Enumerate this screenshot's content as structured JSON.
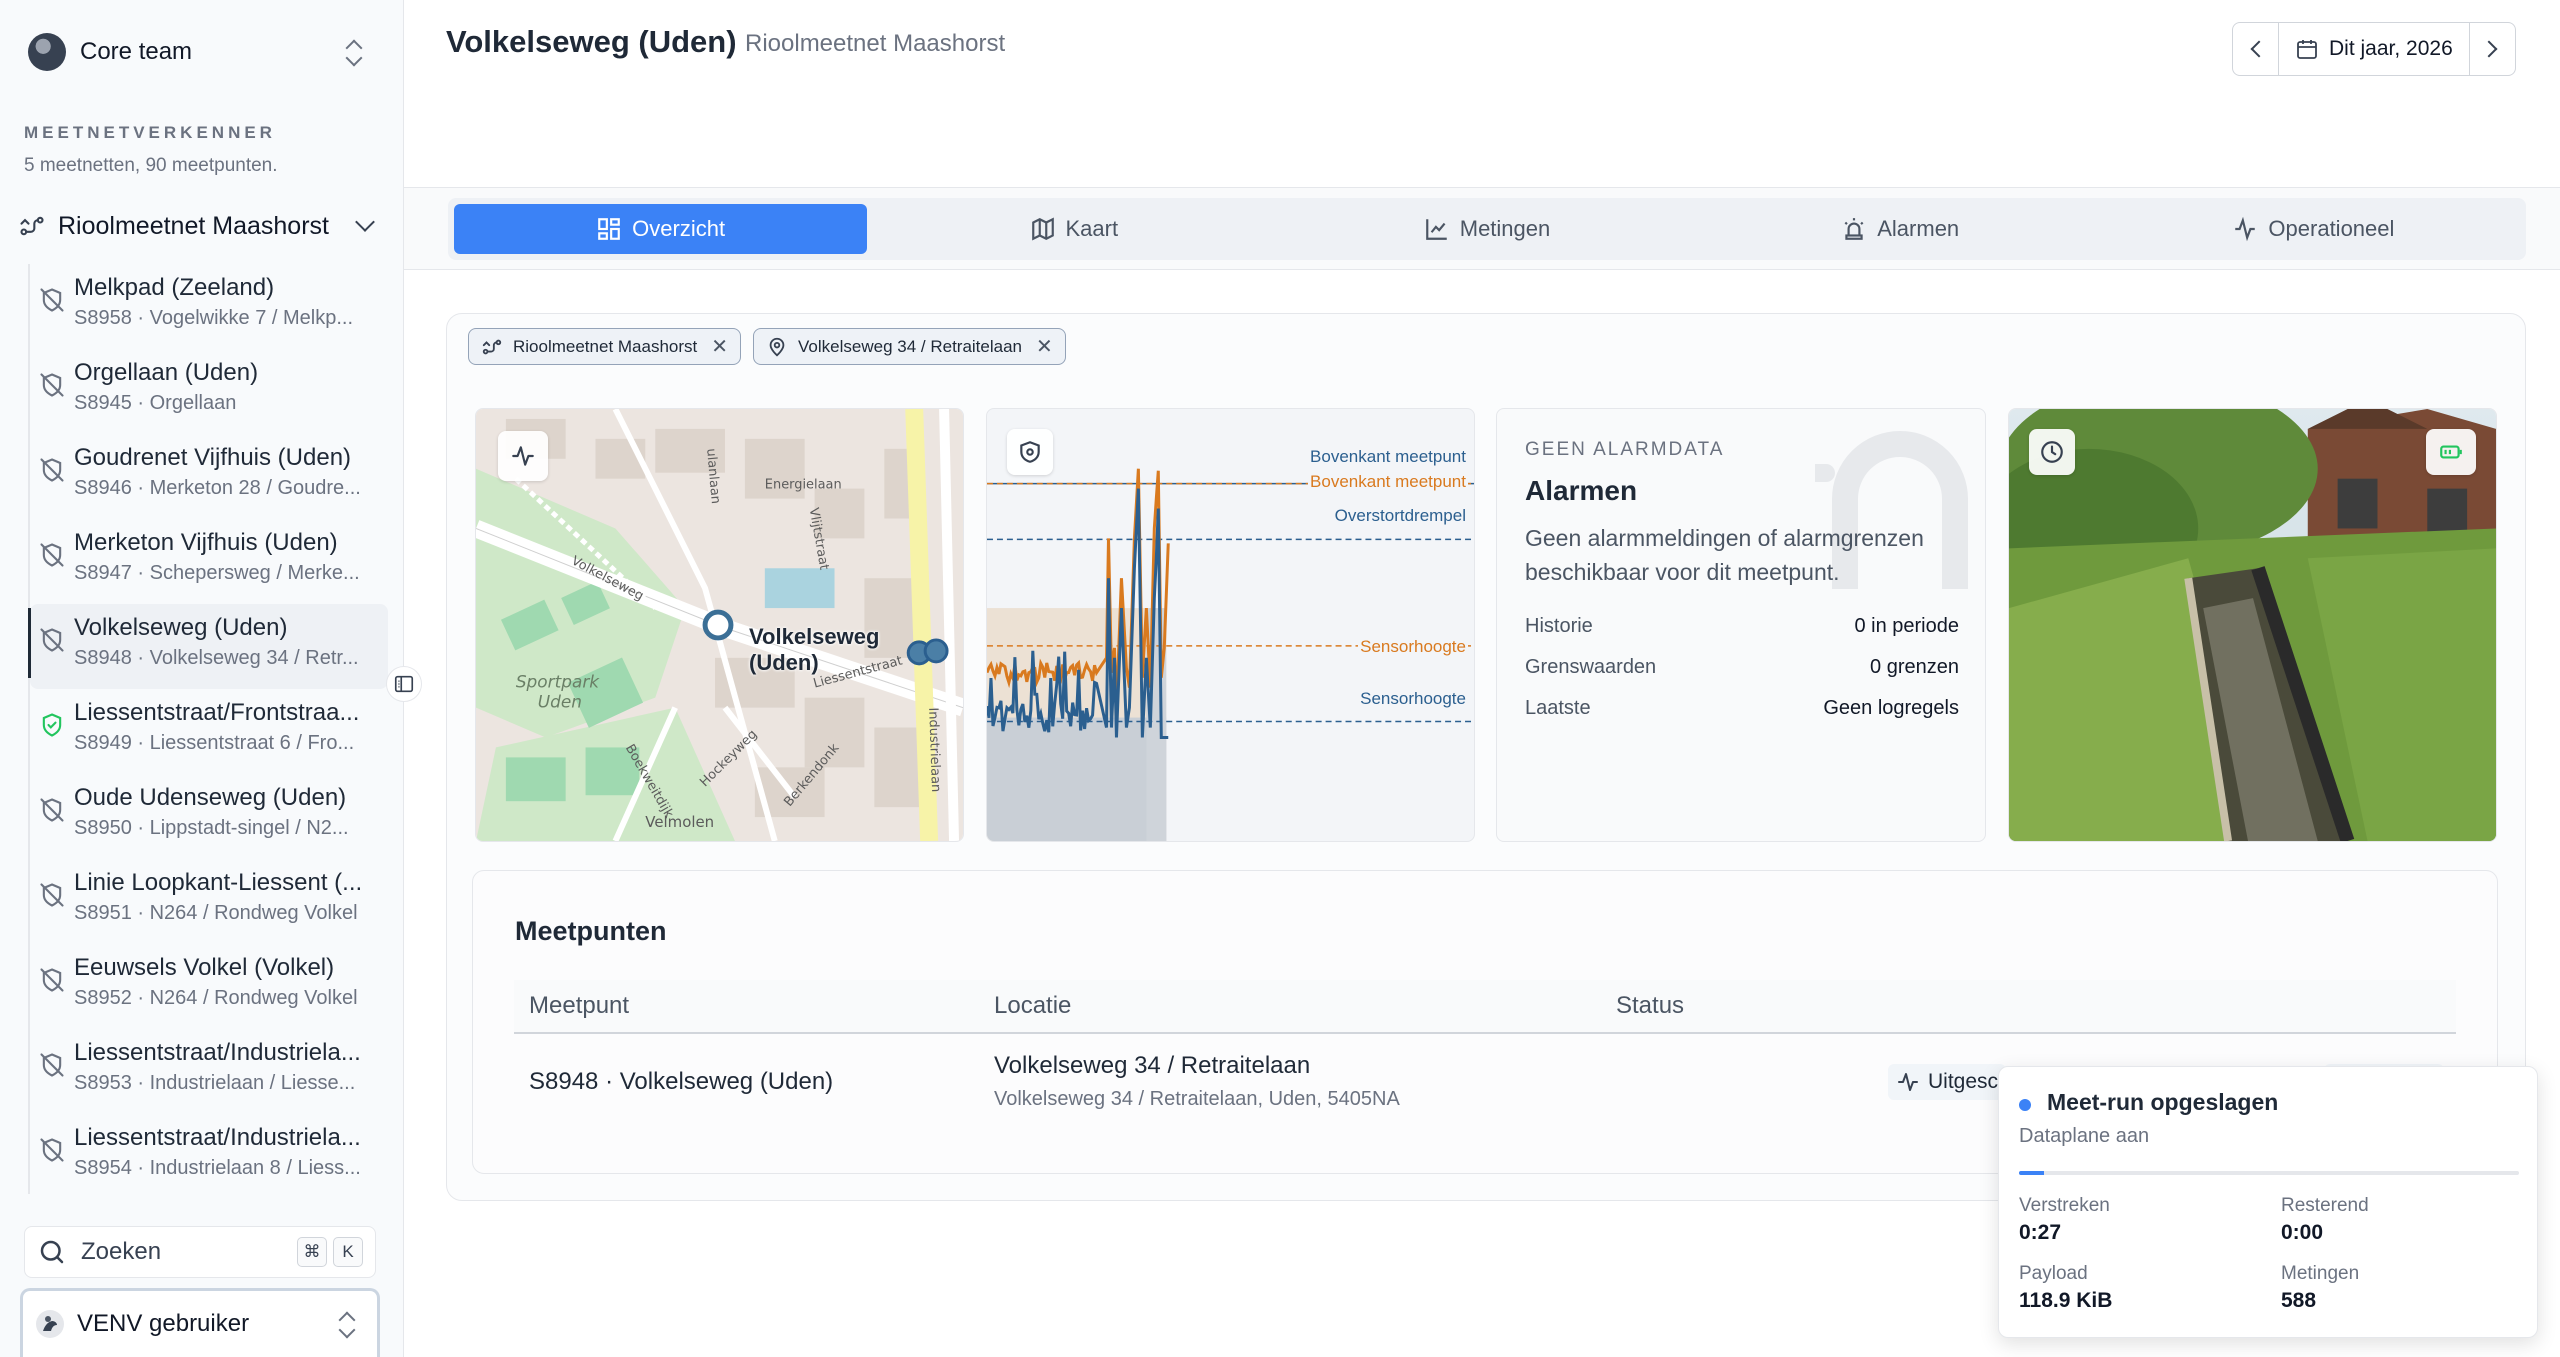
{
  "sidebar": {
    "team": "Core team",
    "section_label": "MEETNETVERKENNER",
    "section_sub": "5 meetnetten, 90 meetpunten.",
    "network": "Rioolmeetnet Maashorst",
    "points": [
      {
        "name": "Melkpad (Zeeland)",
        "sub": "S8958 · Vogelwikke 7 / Melkp...",
        "status": "off"
      },
      {
        "name": "Orgellaan (Uden)",
        "sub": "S8945 · Orgellaan",
        "status": "off"
      },
      {
        "name": "Goudrenet Vijfhuis (Uden)",
        "sub": "S8946 · Merketon 28 / Goudre...",
        "status": "off"
      },
      {
        "name": "Merketon Vijfhuis (Uden)",
        "sub": "S8947 · Schepersweg / Merke...",
        "status": "off"
      },
      {
        "name": "Volkelseweg (Uden)",
        "sub": "S8948 · Volkelseweg 34 / Retr...",
        "status": "off",
        "active": true
      },
      {
        "name": "Liessentstraat/Frontstraa...",
        "sub": "S8949 · Liessentstraat 6 / Fro...",
        "status": "ok"
      },
      {
        "name": "Oude Udenseweg (Uden)",
        "sub": "S8950 · Lippstadt-singel / N2...",
        "status": "off"
      },
      {
        "name": "Linie Loopkant-Liessent (...",
        "sub": "S8951 · N264 / Rondweg Volkel",
        "status": "off"
      },
      {
        "name": "Eeuwsels Volkel (Volkel)",
        "sub": "S8952 · N264 / Rondweg Volkel",
        "status": "off"
      },
      {
        "name": "Liessentstraat/Industriela...",
        "sub": "S8953 · Industrielaan / Liesse...",
        "status": "off"
      },
      {
        "name": "Liessentstraat/Industriela...",
        "sub": "S8954 · Industrielaan 8 / Liess...",
        "status": "off"
      }
    ],
    "search": {
      "label": "Zoeken",
      "kbd1": "⌘",
      "kbd2": "K"
    },
    "user": "VENV gebruiker"
  },
  "header": {
    "title": "Volkelseweg (Uden)",
    "subtitle": "Rioolmeetnet Maashorst",
    "date_label": "Dit jaar, 2026"
  },
  "tabs": [
    {
      "label": "Overzicht",
      "icon": "grid-icon",
      "active": true
    },
    {
      "label": "Kaart",
      "icon": "map-icon"
    },
    {
      "label": "Metingen",
      "icon": "line-chart-icon"
    },
    {
      "label": "Alarmen",
      "icon": "siren-icon"
    },
    {
      "label": "Operationeel",
      "icon": "activity-icon"
    }
  ],
  "filters": [
    {
      "label": "Rioolmeetnet Maashorst",
      "icon": "network-icon"
    },
    {
      "label": "Volkelseweg 34 / Retraitelaan",
      "icon": "pin-icon"
    }
  ],
  "map": {
    "marker_label_1": "Volkelseweg",
    "marker_label_2": "(Uden)",
    "streets": [
      "Volkelseweg",
      "Liessentstraat",
      "Industrielaan",
      "Energielaan",
      "Vlijtstraat",
      "Sportpark",
      "Uden",
      "Boekweitdijk",
      "Hockeyweg",
      "Berkendonk",
      "Velmolen",
      "ulanlaan"
    ]
  },
  "chart_labels": {
    "top1": "Bovenkant meetpunt",
    "top2": "Bovenkant meetpunt",
    "overflow": "Overstortdrempel",
    "sensor1": "Sensorhoogte",
    "sensor2": "Sensorhoogte",
    "colors": {
      "blue": "#2b5f8f",
      "orange": "#d97a1f"
    }
  },
  "alarm": {
    "kicker": "GEEN ALARMDATA",
    "title": "Alarmen",
    "desc": "Geen alarmmeldingen of alarmgrenzen beschikbaar voor dit meetpunt.",
    "rows": [
      {
        "k": "Historie",
        "v": "0 in periode"
      },
      {
        "k": "Grenswaarden",
        "v": "0 grenzen"
      },
      {
        "k": "Laatste",
        "v": "Geen logregels"
      }
    ]
  },
  "meetpunten": {
    "title": "Meetpunten",
    "cols": [
      "Meetpunt",
      "Locatie",
      "Status"
    ],
    "row": {
      "id": "S8948 · Volkelseweg (Uden)",
      "loc1": "Volkelseweg 34 / Retraitelaan",
      "loc2": "Volkelseweg 34 / Retraitelaan, Uden, 5405NA",
      "status": "Uitgesc"
    }
  },
  "toast": {
    "title": "Meet-run opgeslagen",
    "sub": "Dataplane aan",
    "progress": 0.05,
    "elapsed_k": "Verstreken",
    "elapsed_v": "0:27",
    "remain_k": "Resterend",
    "remain_v": "0:00",
    "payload_k": "Payload",
    "payload_v": "118.9 KiB",
    "count_k": "Metingen",
    "count_v": "588"
  }
}
